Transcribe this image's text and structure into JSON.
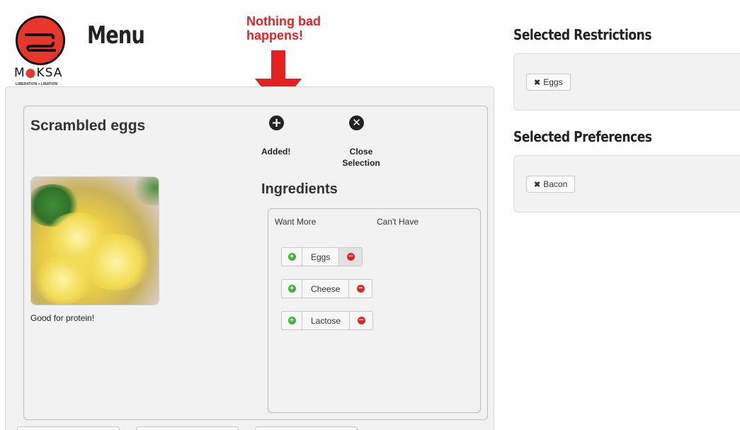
{
  "logo": {
    "name": "MOKSA",
    "name_before_dot": "M",
    "name_dot": "●",
    "name_after_dot": "KSA",
    "tagline": "LIBERATION + LIBATION"
  },
  "header": {
    "title": "Menu"
  },
  "annotation": {
    "text": "Nothing bad happens!",
    "color": "#e62020"
  },
  "dish": {
    "title": "Scrambled eggs",
    "description": "Good for protein!",
    "add_icon": "plus-circle-icon",
    "close_icon": "x-circle-icon",
    "add_label": "Added!",
    "close_label": "Close Selection",
    "ingredients_title": "Ingredients",
    "want_more_header": "Want More",
    "cant_have_header": "Can't Have",
    "ingredients": [
      {
        "name": "Eggs",
        "cant_have_active": true
      },
      {
        "name": "Cheese",
        "cant_have_active": false
      },
      {
        "name": "Lactose",
        "cant_have_active": false
      }
    ]
  },
  "sidebar": {
    "restrictions_heading": "Selected Restrictions",
    "restrictions": [
      "Eggs"
    ],
    "preferences_heading": "Selected Preferences",
    "preferences": [
      "Bacon"
    ],
    "remove_glyph": "✖"
  },
  "colors": {
    "brand_red": "#e8362a",
    "add_green": "#3cb33c",
    "remove_red": "#e0252b"
  }
}
